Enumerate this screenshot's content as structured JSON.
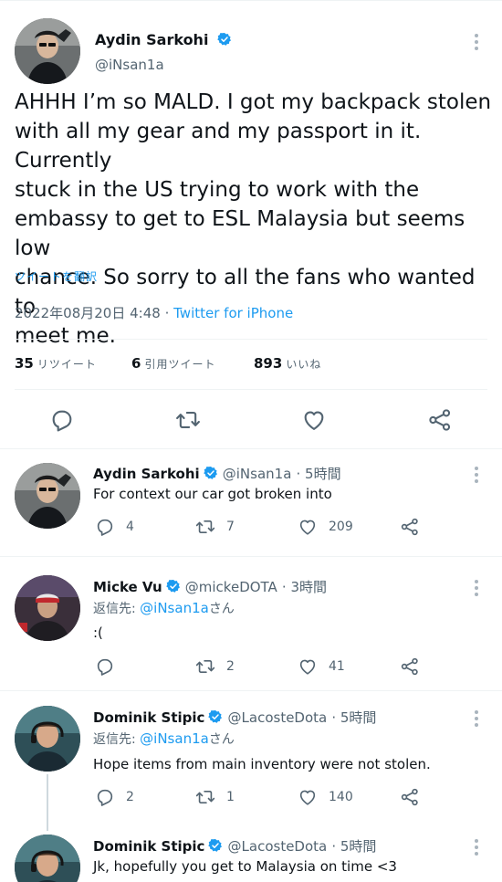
{
  "main_tweet": {
    "author_name": "Aydin Sarkohi",
    "author_handle": "@iNsan1a",
    "text_lines": [
      "AHHH I’m so MALD. I got my backpack stolen",
      "with all my gear and my passport in it. Currently",
      "stuck in the US trying to work with the",
      "embassy to get to ESL Malaysia but seems low",
      "chance. So sorry to all the fans who wanted to",
      "meet me."
    ],
    "translate_label": "ツイートを翻訳",
    "timestamp": "2022年08月20日 4:48",
    "separator": " · ",
    "source": "Twitter for iPhone",
    "stats": {
      "retweets_count": "35",
      "retweets_label": "リツイート",
      "quotes_count": "6",
      "quotes_label": "引用ツイート",
      "likes_count": "893",
      "likes_label": "いいね"
    }
  },
  "replies": [
    {
      "name": "Aydin Sarkohi",
      "handle": "@iNsan1a",
      "time": "· 5時間",
      "replying_prefix": "",
      "replying_mention": "",
      "replying_suffix": "",
      "text": "For context our car got broken into",
      "reply_count": "4",
      "retweet_count": "7",
      "like_count": "209"
    },
    {
      "name": "Micke Vu",
      "handle": "@mickeDOTA",
      "time": "· 3時間",
      "replying_prefix": "返信先: ",
      "replying_mention": "@iNsan1a",
      "replying_suffix": "さん",
      "text": ":(",
      "reply_count": "",
      "retweet_count": "2",
      "like_count": "41"
    },
    {
      "name": "Dominik Stipic",
      "handle": "@LacosteDota",
      "time": "· 5時間",
      "replying_prefix": "返信先: ",
      "replying_mention": "@iNsan1a",
      "replying_suffix": "さん",
      "text": "Hope items from main inventory were not stolen.",
      "reply_count": "2",
      "retweet_count": "1",
      "like_count": "140"
    },
    {
      "name": "Dominik Stipic",
      "handle": "@LacosteDota",
      "time": "· 5時間",
      "text": "Jk, hopefully you get to Malaysia on time <3"
    }
  ],
  "colors": {
    "accent": "#1d9bf0",
    "text": "#0f1419",
    "secondary": "#536471",
    "divider": "#eff3f4"
  },
  "icons": [
    "reply-icon",
    "retweet-icon",
    "like-icon",
    "share-icon",
    "verified-badge-icon",
    "more-icon"
  ]
}
